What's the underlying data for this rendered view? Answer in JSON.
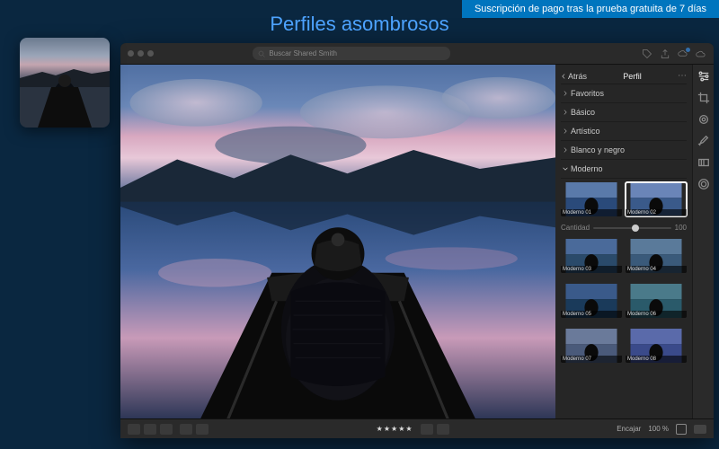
{
  "badge_text": "Suscripción de pago tras la prueba gratuita de 7 días",
  "marketing_title": "Perfiles asombrosos",
  "search": {
    "placeholder": "Buscar Shared Smith"
  },
  "panel": {
    "back_label": "Atrás",
    "title": "Perfil",
    "categories": {
      "favoritos": "Favoritos",
      "basico": "Básico",
      "artistico": "Artístico",
      "blanco_negro": "Blanco y negro",
      "moderno": "Moderno"
    },
    "slider_label": "Cantidad",
    "slider_value": "100",
    "thumbs": [
      {
        "label": "Moderno 01"
      },
      {
        "label": "Moderno 02"
      },
      {
        "label": "Moderno 03"
      },
      {
        "label": "Moderno 04"
      },
      {
        "label": "Moderno 05"
      },
      {
        "label": "Moderno 06"
      },
      {
        "label": "Moderno 07"
      },
      {
        "label": "Moderno 08"
      }
    ]
  },
  "bottombar": {
    "stars": "★★★★★",
    "fit_label": "Encajar",
    "zoom": "100 %"
  }
}
